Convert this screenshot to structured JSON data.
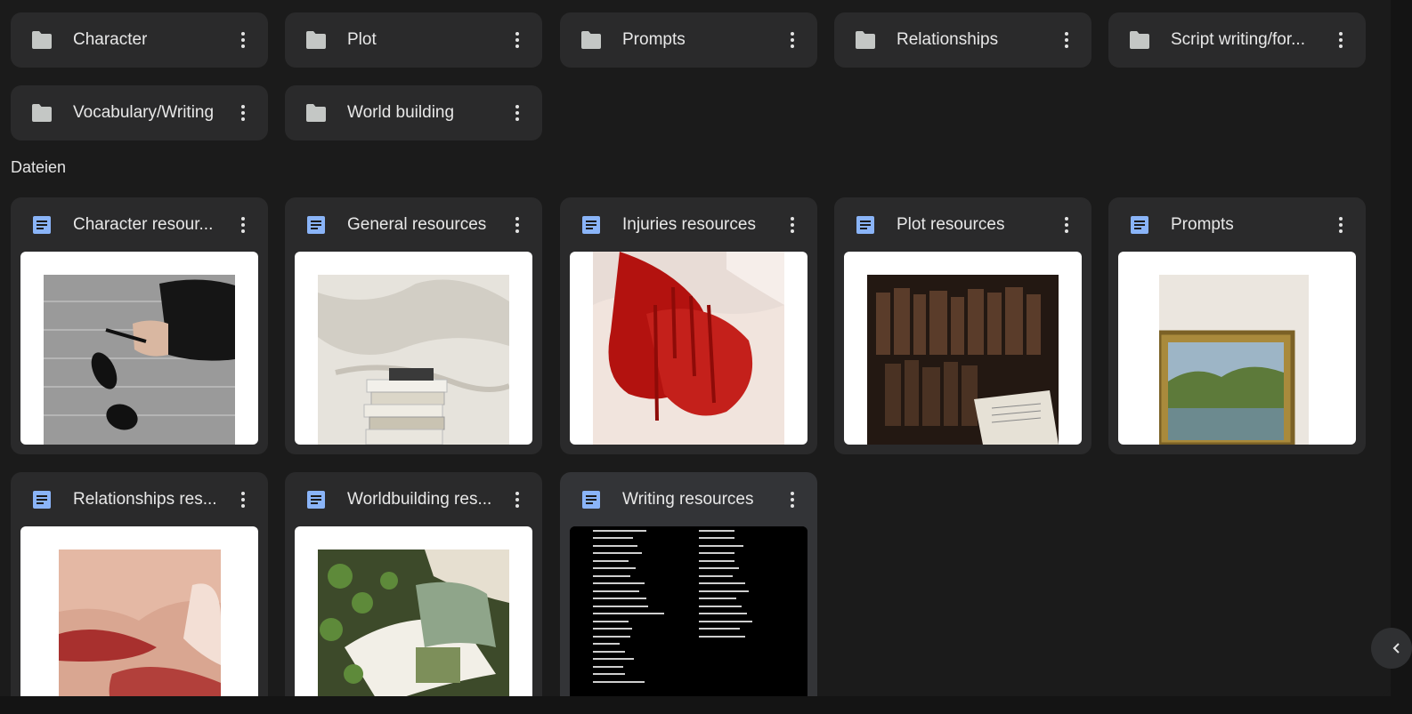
{
  "folders": [
    {
      "name": "Character"
    },
    {
      "name": "Plot"
    },
    {
      "name": "Prompts"
    },
    {
      "name": "Relationships"
    },
    {
      "name": "Script writing/for..."
    },
    {
      "name": "Vocabulary/Writing"
    },
    {
      "name": "World building"
    }
  ],
  "files_section": {
    "label": "Dateien"
  },
  "files": [
    {
      "name": "Character resour...",
      "thumbnail": "hand-with-sunglasses"
    },
    {
      "name": "General resources",
      "thumbnail": "book-stack-on-bed"
    },
    {
      "name": "Injuries resources",
      "thumbnail": "bloody-hand"
    },
    {
      "name": "Plot resources",
      "thumbnail": "old-books-shelf"
    },
    {
      "name": "Prompts",
      "thumbnail": "framed-landscape-painting"
    },
    {
      "name": "Relationships res...",
      "thumbnail": "close-up-lips"
    },
    {
      "name": "Worldbuilding res...",
      "thumbnail": "open-book-with-ivy"
    },
    {
      "name": "Writing resources",
      "thumbnail": "word-list-document"
    }
  ],
  "colors": {
    "doc_icon": "#8ab4f8",
    "folder_icon": "#c4c7c5",
    "card": "#2a2a2b",
    "selected_card": "#333437",
    "background": "#1b1b1b"
  },
  "icons": {
    "folder": "folder-icon",
    "document": "document-icon",
    "more": "more-vert-icon",
    "collapse": "chevron-left-icon"
  }
}
